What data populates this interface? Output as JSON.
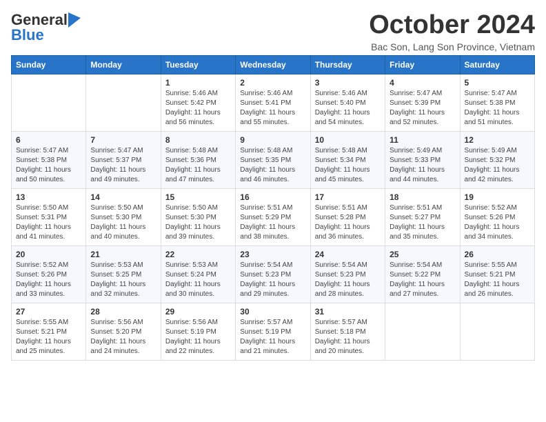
{
  "logo": {
    "general": "General",
    "blue": "Blue"
  },
  "header": {
    "month": "October 2024",
    "location": "Bac Son, Lang Son Province, Vietnam"
  },
  "weekdays": [
    "Sunday",
    "Monday",
    "Tuesday",
    "Wednesday",
    "Thursday",
    "Friday",
    "Saturday"
  ],
  "weeks": [
    [
      {
        "day": null,
        "info": ""
      },
      {
        "day": null,
        "info": ""
      },
      {
        "day": "1",
        "info": "Sunrise: 5:46 AM\nSunset: 5:42 PM\nDaylight: 11 hours and 56 minutes."
      },
      {
        "day": "2",
        "info": "Sunrise: 5:46 AM\nSunset: 5:41 PM\nDaylight: 11 hours and 55 minutes."
      },
      {
        "day": "3",
        "info": "Sunrise: 5:46 AM\nSunset: 5:40 PM\nDaylight: 11 hours and 54 minutes."
      },
      {
        "day": "4",
        "info": "Sunrise: 5:47 AM\nSunset: 5:39 PM\nDaylight: 11 hours and 52 minutes."
      },
      {
        "day": "5",
        "info": "Sunrise: 5:47 AM\nSunset: 5:38 PM\nDaylight: 11 hours and 51 minutes."
      }
    ],
    [
      {
        "day": "6",
        "info": "Sunrise: 5:47 AM\nSunset: 5:38 PM\nDaylight: 11 hours and 50 minutes."
      },
      {
        "day": "7",
        "info": "Sunrise: 5:47 AM\nSunset: 5:37 PM\nDaylight: 11 hours and 49 minutes."
      },
      {
        "day": "8",
        "info": "Sunrise: 5:48 AM\nSunset: 5:36 PM\nDaylight: 11 hours and 47 minutes."
      },
      {
        "day": "9",
        "info": "Sunrise: 5:48 AM\nSunset: 5:35 PM\nDaylight: 11 hours and 46 minutes."
      },
      {
        "day": "10",
        "info": "Sunrise: 5:48 AM\nSunset: 5:34 PM\nDaylight: 11 hours and 45 minutes."
      },
      {
        "day": "11",
        "info": "Sunrise: 5:49 AM\nSunset: 5:33 PM\nDaylight: 11 hours and 44 minutes."
      },
      {
        "day": "12",
        "info": "Sunrise: 5:49 AM\nSunset: 5:32 PM\nDaylight: 11 hours and 42 minutes."
      }
    ],
    [
      {
        "day": "13",
        "info": "Sunrise: 5:50 AM\nSunset: 5:31 PM\nDaylight: 11 hours and 41 minutes."
      },
      {
        "day": "14",
        "info": "Sunrise: 5:50 AM\nSunset: 5:30 PM\nDaylight: 11 hours and 40 minutes."
      },
      {
        "day": "15",
        "info": "Sunrise: 5:50 AM\nSunset: 5:30 PM\nDaylight: 11 hours and 39 minutes."
      },
      {
        "day": "16",
        "info": "Sunrise: 5:51 AM\nSunset: 5:29 PM\nDaylight: 11 hours and 38 minutes."
      },
      {
        "day": "17",
        "info": "Sunrise: 5:51 AM\nSunset: 5:28 PM\nDaylight: 11 hours and 36 minutes."
      },
      {
        "day": "18",
        "info": "Sunrise: 5:51 AM\nSunset: 5:27 PM\nDaylight: 11 hours and 35 minutes."
      },
      {
        "day": "19",
        "info": "Sunrise: 5:52 AM\nSunset: 5:26 PM\nDaylight: 11 hours and 34 minutes."
      }
    ],
    [
      {
        "day": "20",
        "info": "Sunrise: 5:52 AM\nSunset: 5:26 PM\nDaylight: 11 hours and 33 minutes."
      },
      {
        "day": "21",
        "info": "Sunrise: 5:53 AM\nSunset: 5:25 PM\nDaylight: 11 hours and 32 minutes."
      },
      {
        "day": "22",
        "info": "Sunrise: 5:53 AM\nSunset: 5:24 PM\nDaylight: 11 hours and 30 minutes."
      },
      {
        "day": "23",
        "info": "Sunrise: 5:54 AM\nSunset: 5:23 PM\nDaylight: 11 hours and 29 minutes."
      },
      {
        "day": "24",
        "info": "Sunrise: 5:54 AM\nSunset: 5:23 PM\nDaylight: 11 hours and 28 minutes."
      },
      {
        "day": "25",
        "info": "Sunrise: 5:54 AM\nSunset: 5:22 PM\nDaylight: 11 hours and 27 minutes."
      },
      {
        "day": "26",
        "info": "Sunrise: 5:55 AM\nSunset: 5:21 PM\nDaylight: 11 hours and 26 minutes."
      }
    ],
    [
      {
        "day": "27",
        "info": "Sunrise: 5:55 AM\nSunset: 5:21 PM\nDaylight: 11 hours and 25 minutes."
      },
      {
        "day": "28",
        "info": "Sunrise: 5:56 AM\nSunset: 5:20 PM\nDaylight: 11 hours and 24 minutes."
      },
      {
        "day": "29",
        "info": "Sunrise: 5:56 AM\nSunset: 5:19 PM\nDaylight: 11 hours and 22 minutes."
      },
      {
        "day": "30",
        "info": "Sunrise: 5:57 AM\nSunset: 5:19 PM\nDaylight: 11 hours and 21 minutes."
      },
      {
        "day": "31",
        "info": "Sunrise: 5:57 AM\nSunset: 5:18 PM\nDaylight: 11 hours and 20 minutes."
      },
      {
        "day": null,
        "info": ""
      },
      {
        "day": null,
        "info": ""
      }
    ]
  ]
}
